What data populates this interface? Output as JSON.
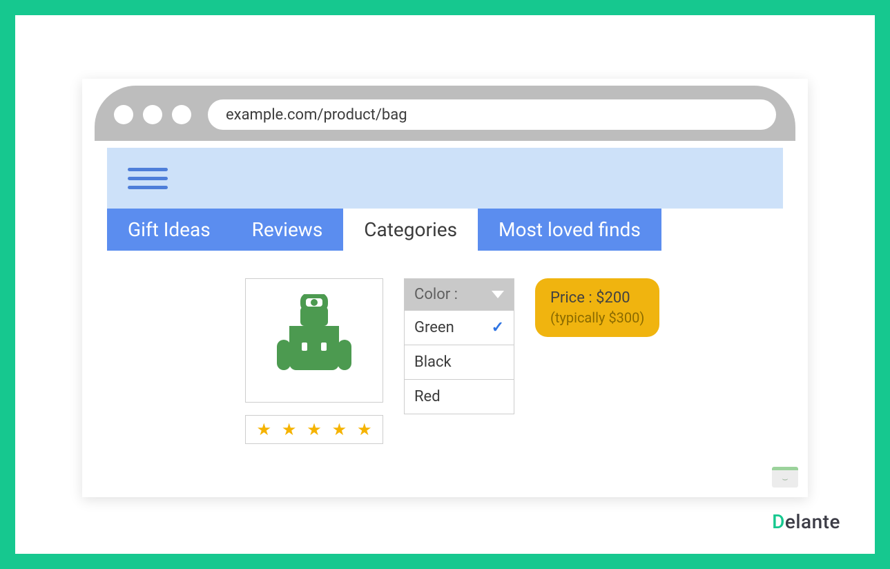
{
  "browser": {
    "url": "example.com/product/bag"
  },
  "nav": {
    "tabs": [
      {
        "label": "Gift Ideas"
      },
      {
        "label": "Reviews"
      },
      {
        "label": "Categories"
      },
      {
        "label": "Most loved finds"
      }
    ],
    "active_index": 2
  },
  "product": {
    "icon": "backpack",
    "rating_stars": 5,
    "color_label": "Color :",
    "color_options": [
      {
        "name": "Green",
        "selected": true
      },
      {
        "name": "Black",
        "selected": false
      },
      {
        "name": "Red",
        "selected": false
      }
    ],
    "price_label": "Price : $200",
    "price_typical": "(typically $300)"
  },
  "brand": {
    "name": "Delante"
  }
}
